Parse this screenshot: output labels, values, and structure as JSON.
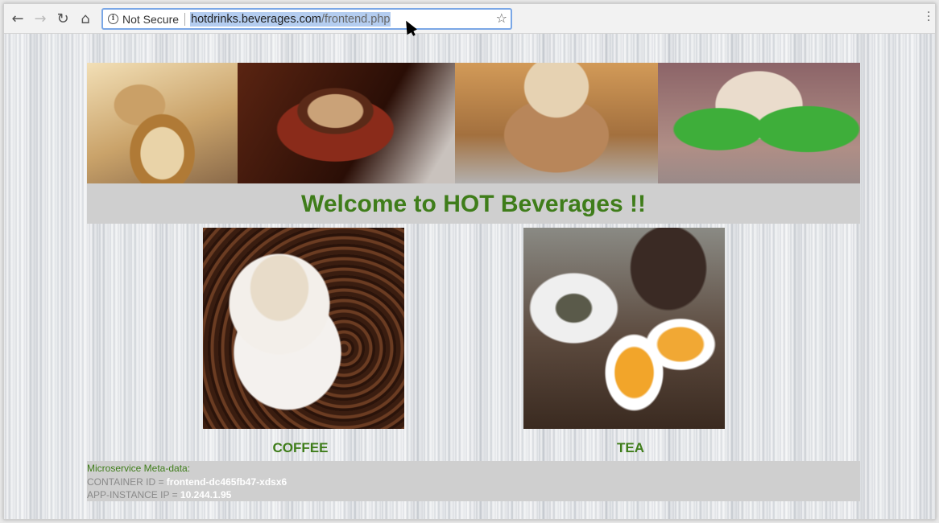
{
  "browser": {
    "security_label": "Not Secure",
    "url_host": "hotdrinks.beverages.com",
    "url_path": "/frontend.php",
    "icons": [
      "back-arrow-icon",
      "forward-arrow-icon",
      "reload-icon",
      "home-icon",
      "info-icon",
      "star-icon",
      "menu-icon"
    ]
  },
  "page": {
    "welcome_title": "Welcome to HOT Beverages !!",
    "products": [
      {
        "label": "COFFEE"
      },
      {
        "label": "TEA"
      }
    ],
    "meta": {
      "title": "Microservice Meta-data:",
      "container_id_label": "CONTAINER ID = ",
      "container_id_value": "frontend-dc465fb47-xdsx6",
      "app_ip_label": "APP-INSTANCE IP = ",
      "app_ip_value": "10.244.1.95"
    }
  },
  "colors": {
    "accent_green": "#3f7d1a",
    "panel_gray": "#cfcfcf",
    "url_highlight": "#b4cdf0"
  }
}
